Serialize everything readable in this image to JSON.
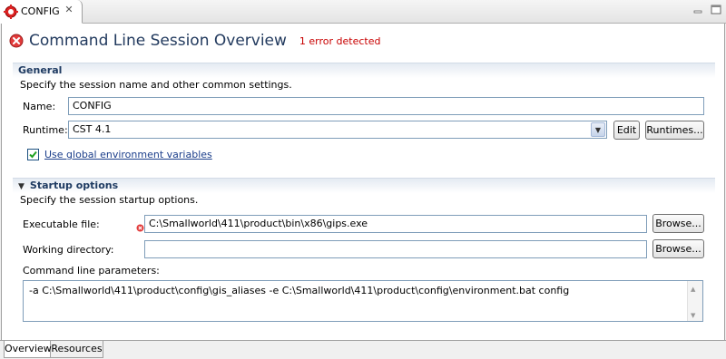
{
  "editor_tab": {
    "label": "CONFIG",
    "close_glyph": "✕"
  },
  "form": {
    "title": "Command Line Session Overview",
    "error_message": "1 error detected"
  },
  "general": {
    "heading": "General",
    "description": "Specify the session name and other common settings.",
    "name_label": "Name:",
    "name_value": "CONFIG",
    "runtime_label": "Runtime:",
    "runtime_value": "CST 4.1",
    "edit_button": "Edit",
    "runtimes_button": "Runtimes...",
    "use_global_env_label": "Use global environment variables",
    "use_global_env_checked": true
  },
  "startup": {
    "heading": "Startup options",
    "description": "Specify the session startup options.",
    "executable_label": "Executable file:",
    "executable_value": "C:\\Smallworld\\411\\product\\bin\\x86\\gips.exe",
    "working_dir_label": "Working directory:",
    "working_dir_value": "",
    "browse_button": "Browse...",
    "cmdline_label": "Command line parameters:",
    "cmdline_value": "-a C:\\Smallworld\\411\\product\\config\\gis_aliases -e C:\\Smallworld\\411\\product\\config\\environment.bat config"
  },
  "page_tabs": [
    "Overview",
    "Resources"
  ],
  "icons": {
    "tab": "config-session-icon",
    "error": "error-icon",
    "minimize": "minimize-icon",
    "maximize": "maximize-icon"
  },
  "colors": {
    "title": "#223a5e",
    "error": "#c80000",
    "section_heading": "#1f3b62",
    "link": "#1a3d8a"
  }
}
